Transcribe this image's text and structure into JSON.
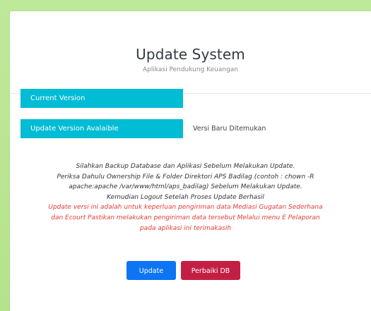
{
  "header": {
    "title": "Update System",
    "subtitle": "Aplikasi Pendukung Keuangan"
  },
  "info": {
    "current_version_label": "Current Version",
    "current_version_value": "",
    "update_version_label": "Update Version Avalaible",
    "update_version_value": "Versi Baru Ditemukan"
  },
  "notice": {
    "lines": [
      "Silahkan Backup Database dan Aplikasi Sebelum Melakukan Update.",
      "Periksa Dahulu Ownership File & Folder Direktori APS Badilag (contoh : chown -R",
      "apache:apache /var/www/html/aps_badilag) Sebelum Melakukan Update.",
      "Kemudian Logout Setelah Proses Update Berhasil"
    ],
    "warning_lines": [
      "Update versi ini adalah untuk keperluan pengiriman data Mediasi Gugatan Sederhana",
      "dan Ecourt Pastikan melakukan pengiriman data tersebut Melalui menu E Pelaporan",
      "pada aplikasi ini terimakasih"
    ]
  },
  "buttons": {
    "update_label": "Update",
    "repair_label": "Perbaiki DB"
  },
  "colors": {
    "background": "#b9e68f",
    "info_label_bg": "#00bcd4",
    "update_button": "#0d74f3",
    "repair_button": "#c31f45",
    "warning_text": "#e53935"
  }
}
